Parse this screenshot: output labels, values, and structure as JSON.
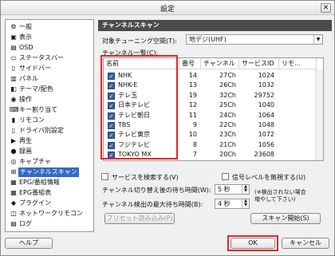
{
  "window": {
    "title": "設定",
    "close_glyph": "✕"
  },
  "sidebar": {
    "items": [
      {
        "label": "一般",
        "icon": "settings-icon",
        "glyph": "⚙"
      },
      {
        "label": "表示",
        "icon": "display-icon",
        "glyph": "▣"
      },
      {
        "label": "OSD",
        "icon": "osd-icon",
        "glyph": "▤"
      },
      {
        "label": "ステータスバー",
        "icon": "statusbar-icon",
        "glyph": "▭"
      },
      {
        "label": "サイドバー",
        "icon": "sidebar-icon",
        "glyph": "▯"
      },
      {
        "label": "パネル",
        "icon": "panel-icon",
        "glyph": "▥"
      },
      {
        "label": "テーマ/配色",
        "icon": "theme-icon",
        "glyph": "◧"
      },
      {
        "label": "操作",
        "icon": "operation-icon",
        "glyph": "◉"
      },
      {
        "label": "キー割り当て",
        "icon": "keyboard-icon",
        "glyph": "⌨"
      },
      {
        "label": "リモコン",
        "icon": "remote-icon",
        "glyph": "▮"
      },
      {
        "label": "ドライバ別設定",
        "icon": "driver-icon",
        "glyph": "▯"
      },
      {
        "label": "再生",
        "icon": "play-icon",
        "glyph": "▶"
      },
      {
        "label": "録画",
        "icon": "record-icon",
        "glyph": "●"
      },
      {
        "label": "キャプチャ",
        "icon": "capture-icon",
        "glyph": "◎"
      },
      {
        "label": "チャンネルスキャン",
        "icon": "channel-scan-icon",
        "glyph": "⊞",
        "selected": true
      },
      {
        "label": "EPG/番組情報",
        "icon": "epg-icon",
        "glyph": "▦"
      },
      {
        "label": "EPG番組表",
        "icon": "program-guide-icon",
        "glyph": "▦"
      },
      {
        "label": "プラグイン",
        "icon": "plugin-icon",
        "glyph": "◆"
      },
      {
        "label": "ネットワークリモコン",
        "icon": "network-remote-icon",
        "glyph": "◫"
      },
      {
        "label": "ログ",
        "icon": "log-icon",
        "glyph": "▤"
      }
    ]
  },
  "page": {
    "header": "チャンネルスキャン",
    "tuning_space_label": "対象チューニング空間(T):",
    "tuning_space_value": "地デジ(UHF)",
    "channel_list_label": "チャンネル一覧(C):",
    "columns": [
      "名前",
      "番号",
      "チャンネル",
      "サービスID",
      "リモ..."
    ],
    "channels": [
      {
        "name": "NHK",
        "number": "14",
        "channel": "27Ch",
        "sid": "1024"
      },
      {
        "name": "NHK-E",
        "number": "13",
        "channel": "26Ch",
        "sid": "1032"
      },
      {
        "name": "テレ玉",
        "number": "19",
        "channel": "32Ch",
        "sid": "29752"
      },
      {
        "name": "日本テレビ",
        "number": "12",
        "channel": "25Ch",
        "sid": "1040"
      },
      {
        "name": "テレビ朝日",
        "number": "11",
        "channel": "24Ch",
        "sid": "1064"
      },
      {
        "name": "TBS",
        "number": "9",
        "channel": "22Ch",
        "sid": "1048"
      },
      {
        "name": "テレビ東京",
        "number": "10",
        "channel": "23Ch",
        "sid": "1072"
      },
      {
        "name": "フジテレビ",
        "number": "8",
        "channel": "21Ch",
        "sid": "1056"
      },
      {
        "name": "TOKYO MX",
        "number": "7",
        "channel": "20Ch",
        "sid": "23608"
      }
    ],
    "search_services_label": "サービスを検索する(V)",
    "ignore_signal_label": "信号レベルを無視する(U)",
    "wait_label": "チャンネル切り替え後の待ち時間(W):",
    "wait_value": "5 秒",
    "max_wait_label": "チャンネル検出の最大待ち時間(B):",
    "max_wait_value": "4 秒",
    "note": "(※検出されない場合\n増やして下さい)",
    "preset_button": "プリセット読み込み(P)",
    "scan_button": "スキャン開始(S)"
  },
  "footer": {
    "help_button": "ヘルプ",
    "ok_button": "OK",
    "cancel_button": "キャンセル"
  },
  "colors": {
    "selection": "#3169c6",
    "header_bg": "#4b4b4b",
    "highlight": "#e0262a",
    "checkbox": "#3b5fa0"
  }
}
